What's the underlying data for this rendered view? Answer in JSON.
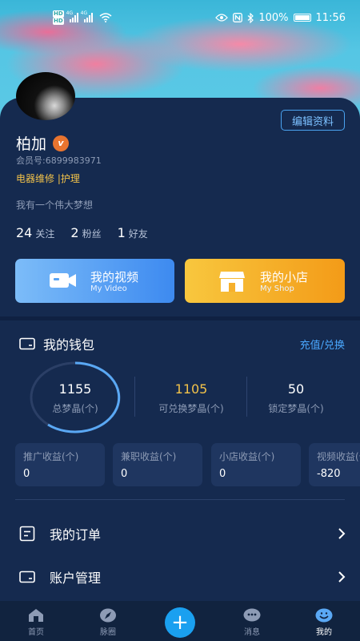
{
  "status_bar": {
    "left_badges": [
      "HD",
      "HD"
    ],
    "signal_labels": [
      "4G",
      "4G"
    ],
    "battery": "100%",
    "time": "11:56",
    "icons": [
      "eye-icon",
      "nfc-icon",
      "bluetooth-icon",
      "battery-icon",
      "wifi-icon"
    ]
  },
  "profile": {
    "edit_label": "编辑资料",
    "name": "柏加",
    "vip_badge": "v",
    "member_no": "会员号:6899983971",
    "tags": "电器维修 |护理",
    "motto": "我有一个伟大梦想",
    "stats": [
      {
        "num": "24",
        "label": "关注"
      },
      {
        "num": "2",
        "label": "粉丝"
      },
      {
        "num": "1",
        "label": "好友"
      }
    ]
  },
  "actions": {
    "video": {
      "title": "我的视频",
      "subtitle": "My Video"
    },
    "shop": {
      "title": "我的小店",
      "subtitle": "My Shop"
    }
  },
  "wallet": {
    "title": "我的钱包",
    "recharge": "充值/兑换",
    "stats": [
      {
        "value": "1155",
        "label": "总梦晶(个)"
      },
      {
        "value": "1105",
        "label": "可兑换梦晶(个)"
      },
      {
        "value": "50",
        "label": "锁定梦晶(个)"
      }
    ],
    "income": [
      {
        "label": "推广收益(个)",
        "value": "0"
      },
      {
        "label": "兼职收益(个)",
        "value": "0"
      },
      {
        "label": "小店收益(个)",
        "value": "0"
      },
      {
        "label": "视频收益(个)",
        "value": "-820"
      }
    ],
    "colors": {
      "accent": "#4aa8ff",
      "highlight": "#f2c24a"
    }
  },
  "menu": [
    {
      "label": "我的订单"
    },
    {
      "label": "账户管理"
    }
  ],
  "tabs": [
    {
      "label": "首页",
      "icon": "home-icon"
    },
    {
      "label": "脉圈",
      "icon": "compass-icon"
    },
    {
      "label": "",
      "icon": "plus-icon"
    },
    {
      "label": "消息",
      "icon": "chat-icon"
    },
    {
      "label": "我的",
      "icon": "user-icon",
      "active": true
    }
  ]
}
